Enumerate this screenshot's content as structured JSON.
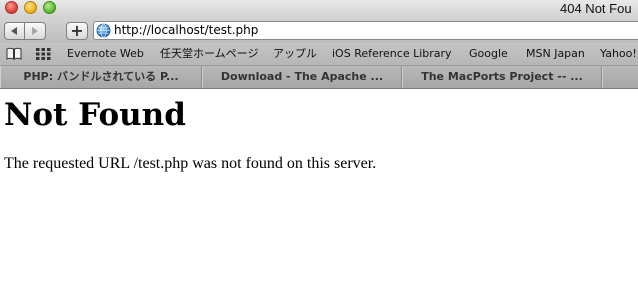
{
  "window": {
    "title": "404 Not Fou"
  },
  "toolbar": {
    "back_icon": "chevron-left-icon",
    "forward_icon": "chevron-right-icon",
    "add_bookmark_label": "+",
    "address_icon": "globe-icon",
    "address_value": "http://localhost/test.php"
  },
  "bookmarks_bar": {
    "book_icon": "open-book-icon",
    "grid_icon": "grid-icon",
    "items": [
      "Evernote Web",
      "任天堂ホームページ",
      "アップル",
      "iOS Reference Library",
      "Google",
      "MSN Japan",
      "Yahoo!"
    ]
  },
  "tabs": [
    {
      "label": "PHP: バンドルされている P..."
    },
    {
      "label": "Download - The Apache ..."
    },
    {
      "label": "The MacPorts Project -- ..."
    },
    {
      "label": ""
    }
  ],
  "page": {
    "heading": "Not Found",
    "message": "The requested URL /test.php was not found on this server."
  }
}
